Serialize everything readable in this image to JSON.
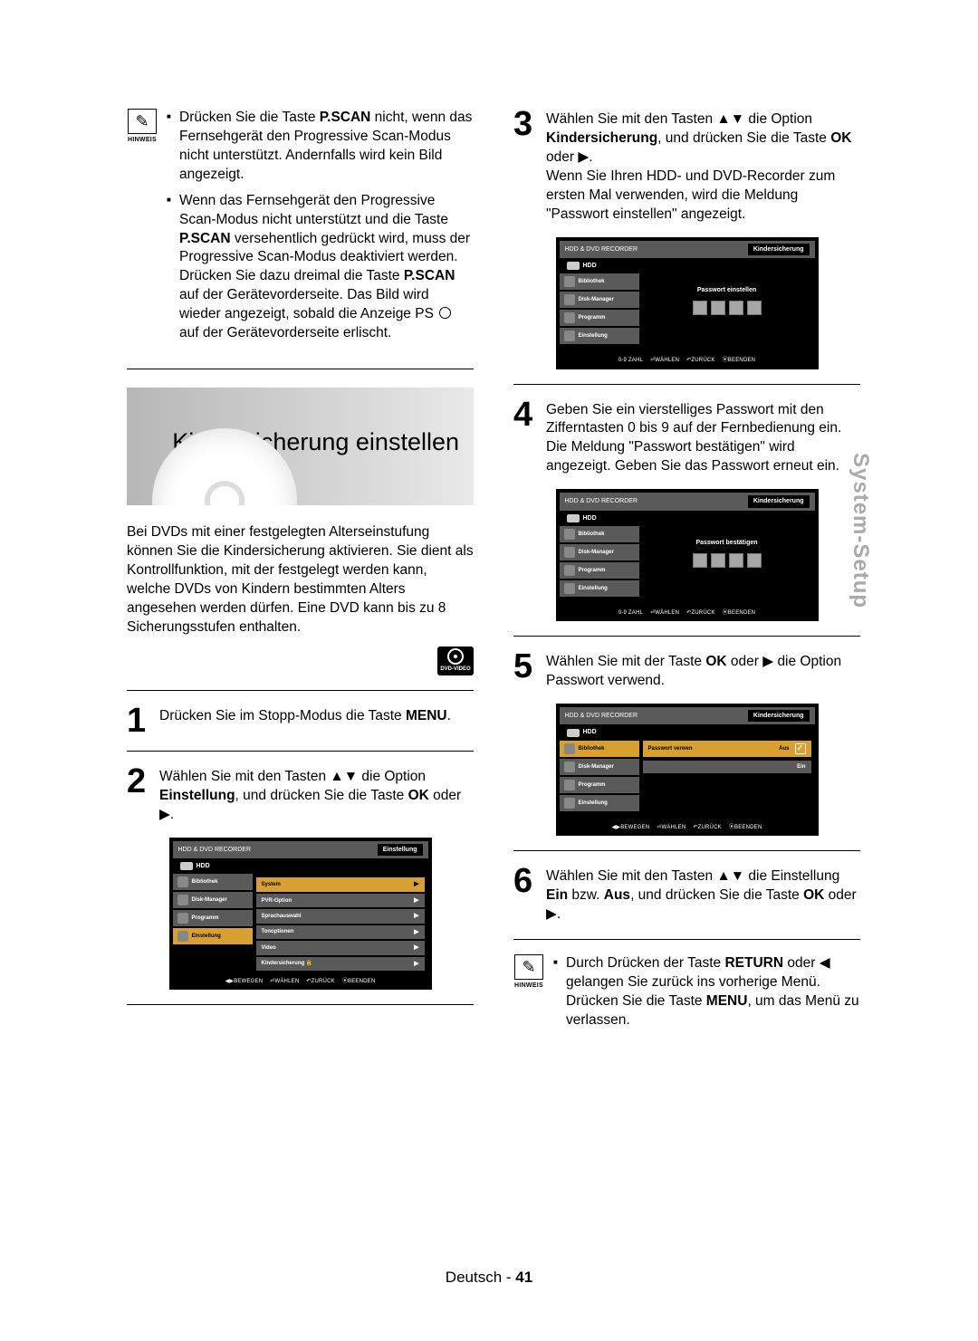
{
  "sideTab": "System-Setup",
  "hinweisLabel": "HINWEIS",
  "hinweis_top": {
    "b1_pre": "Drücken Sie die Taste ",
    "b1_bold": "P.SCAN",
    "b1_post": " nicht, wenn das Fernsehgerät den Progressive Scan-Modus nicht unterstützt. Andernfalls wird kein Bild angezeigt.",
    "b2_pre": "Wenn das Fernsehgerät den Progressive Scan-Modus nicht unterstützt und die Taste ",
    "b2_bold": "P.SCAN",
    "b2_mid": " versehentlich gedrückt wird, muss der Progressive Scan-Modus deaktiviert werden. Drücken Sie dazu dreimal die Taste ",
    "b2_bold2": "P.SCAN",
    "b2_post": " auf der Gerätevorderseite. Das Bild wird wieder angezeigt, sobald die Anzeige PS ",
    "b2_end": " auf der Gerätevorderseite erlischt."
  },
  "sectionTitle": "Kindersicherung einstellen",
  "intro": "Bei DVDs mit einer festgelegten Alterseinstufung können Sie die Kindersicherung aktivieren. Sie dient als Kontrollfunktion, mit der festgelegt werden kann, welche DVDs von Kindern bestimmten Alters angesehen werden dürfen. Eine DVD kann bis zu 8 Sicherungsstufen enthalten.",
  "dvdBadge": "DVD-VIDEO",
  "step1": {
    "num": "1",
    "pre": "Drücken Sie im Stopp-Modus die Taste ",
    "bold": "MENU",
    "post": "."
  },
  "step2": {
    "num": "2",
    "pre": "Wählen Sie mit den Tasten ▲▼ die Option ",
    "bold": "Einstellung",
    "mid": ", und drücken Sie die Taste ",
    "bold2": "OK",
    "post": " oder ▶."
  },
  "step3": {
    "num": "3",
    "pre": "Wählen Sie mit den Tasten ▲▼ die Option ",
    "bold": "Kindersicherung",
    "mid": ", und drücken Sie die Taste ",
    "bold2": "OK",
    "post": " oder ▶.",
    "extra": "Wenn Sie Ihren HDD- und DVD-Recorder zum ersten Mal verwenden, wird die Meldung \"Passwort einstellen\" angezeigt."
  },
  "step4": {
    "num": "4",
    "text": "Geben Sie ein vierstelliges Passwort mit den Zifferntasten 0 bis 9 auf der Fernbedienung ein. Die Meldung \"Passwort bestätigen\" wird angezeigt. Geben Sie das Passwort erneut ein."
  },
  "step5": {
    "num": "5",
    "pre": "Wählen Sie mit der Taste ",
    "bold": "OK",
    "mid": " oder ▶  die Option Passwort verwend."
  },
  "step6": {
    "num": "6",
    "pre": "Wählen Sie mit den Tasten ▲▼ die Einstellung ",
    "bold": "Ein",
    "mid": " bzw. ",
    "bold2": "Aus",
    "mid2": ", und drücken Sie die Taste ",
    "bold3": "OK",
    "post": " oder ▶."
  },
  "hinweis_bottom": {
    "b1_pre": "Durch Drücken der Taste ",
    "b1_bold": "RETURN",
    "b1_mid": " oder ◀ gelangen Sie zurück ins vorherige Menü. Drücken Sie die Taste ",
    "b1_bold2": "MENU",
    "b1_post": ", um das Menü zu verlassen."
  },
  "osd": {
    "header": "HDD & DVD RECORDER",
    "hdd": "HDD",
    "side": [
      "Bibliothek",
      "Disk-Manager",
      "Programm",
      "Einstellung"
    ],
    "screen1": {
      "title": "Einstellung",
      "items": [
        "System",
        "PVR-Option",
        "Sprachauswahl",
        "Tonoptionen",
        "Video",
        "Kindersicherung 🔒"
      ]
    },
    "screen2": {
      "title": "Kindersicherung",
      "prompt": "Passwort einstellen"
    },
    "screen3": {
      "title": "Kindersicherung",
      "prompt": "Passwort bestätigen"
    },
    "screen4": {
      "title": "Kindersicherung",
      "label": "Passwort verwen",
      "opts": [
        "Aus",
        "Ein"
      ]
    },
    "footA": [
      "◀▶BEWEGEN",
      "⏎WÄHLEN",
      "↶ZURÜCK",
      "⦿BEENDEN"
    ],
    "footB": [
      "0-9 ZAHL",
      "⏎WÄHLEN",
      "↶ZURÜCK",
      "⦿BEENDEN"
    ]
  },
  "footer": {
    "lang": "Deutsch",
    "page": "41"
  }
}
